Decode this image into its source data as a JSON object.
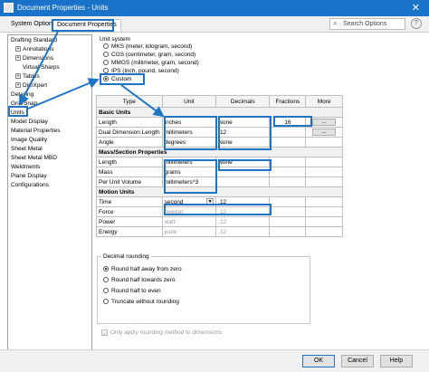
{
  "window": {
    "title": "Document Properties - Units",
    "close": "✕"
  },
  "tabs": [
    {
      "label": "System Options"
    },
    {
      "label": "Document Properties"
    }
  ],
  "search": {
    "placeholder": "Search Options"
  },
  "sidebar": {
    "items": [
      {
        "label": "Drafting Standard",
        "indent": 0
      },
      {
        "label": "Annotations",
        "indent": 1,
        "expander": "+"
      },
      {
        "label": "Dimensions",
        "indent": 1,
        "expander": "+"
      },
      {
        "label": "Virtual Sharps",
        "indent": 2
      },
      {
        "label": "Tables",
        "indent": 1,
        "expander": "+"
      },
      {
        "label": "DimXpert",
        "indent": 1,
        "expander": "+"
      },
      {
        "label": "Detailing",
        "indent": 0
      },
      {
        "label": "Grid/Snap",
        "indent": 0
      },
      {
        "label": "Units",
        "indent": 0
      },
      {
        "label": "Model Display",
        "indent": 0
      },
      {
        "label": "Material Properties",
        "indent": 0
      },
      {
        "label": "Image Quality",
        "indent": 0
      },
      {
        "label": "Sheet Metal",
        "indent": 0
      },
      {
        "label": "Sheet Metal MBD",
        "indent": 0
      },
      {
        "label": "Weldments",
        "indent": 0
      },
      {
        "label": "Plane Display",
        "indent": 0
      },
      {
        "label": "Configurations",
        "indent": 0
      }
    ]
  },
  "unit_system": {
    "label": "Unit system",
    "options": [
      {
        "label": "MKS  (meter, kilogram, second)",
        "selected": false
      },
      {
        "label": "CGS  (centimeter, gram, second)",
        "selected": false
      },
      {
        "label": "MMGS (millimeter, gram, second)",
        "selected": false
      },
      {
        "label": "IPS  (inch, pound, second)",
        "selected": false
      },
      {
        "label": "Custom",
        "selected": true
      }
    ]
  },
  "table": {
    "headers": [
      "Type",
      "Unit",
      "Decimals",
      "Fractions",
      "More"
    ],
    "sections": [
      {
        "title": "Basic Units",
        "rows": [
          {
            "type": "Length",
            "unit": "inches",
            "decimals": "None",
            "fractions": "16",
            "more": "...",
            "disabled": false
          },
          {
            "type": "Dual Dimension Length",
            "unit": "millimeters",
            "decimals": ".12",
            "fractions": "",
            "more": "...",
            "disabled": false
          },
          {
            "type": "Angle",
            "unit": "degrees",
            "decimals": "None",
            "fractions": "",
            "more": "",
            "disabled": false
          }
        ]
      },
      {
        "title": "Mass/Section Properties",
        "rows": [
          {
            "type": "Length",
            "unit": "millimeters",
            "decimals": "None",
            "fractions": "",
            "more": "",
            "disabled": false
          },
          {
            "type": "Mass",
            "unit": "grams",
            "decimals": "",
            "fractions": "",
            "more": "",
            "disabled": false
          },
          {
            "type": "Per Unit Volume",
            "unit": "millimeters^3",
            "decimals": "",
            "fractions": "",
            "more": "",
            "disabled": false
          }
        ]
      },
      {
        "title": "Motion Units",
        "rows": [
          {
            "type": "Time",
            "unit": "second",
            "decimals": ".12",
            "fractions": "",
            "more": "",
            "disabled": false
          },
          {
            "type": "Force",
            "unit": "newton",
            "decimals": ".12",
            "fractions": "",
            "more": "",
            "disabled": true
          },
          {
            "type": "Power",
            "unit": "watt",
            "decimals": ".12",
            "fractions": "",
            "more": "",
            "disabled": true
          },
          {
            "type": "Energy",
            "unit": "joule",
            "decimals": ".12",
            "fractions": "",
            "more": "",
            "disabled": true
          }
        ]
      }
    ]
  },
  "rounding": {
    "label": "Decimal rounding",
    "options": [
      {
        "label": "Round half away from zero",
        "selected": true
      },
      {
        "label": "Round half towards zero",
        "selected": false
      },
      {
        "label": "Round half to even",
        "selected": false
      },
      {
        "label": "Truncate without rounding",
        "selected": false
      }
    ],
    "apply_label": "Only apply rounding method to dimensions",
    "apply_checked": true
  },
  "footer": {
    "ok": "OK",
    "cancel": "Cancel",
    "help": "Help"
  },
  "colors": {
    "accent": "#1e74c7",
    "titlebar": "#1a73c8"
  },
  "icons": [
    "search-icon",
    "help-icon",
    "close-icon",
    "dropdown-arrow-icon"
  ]
}
